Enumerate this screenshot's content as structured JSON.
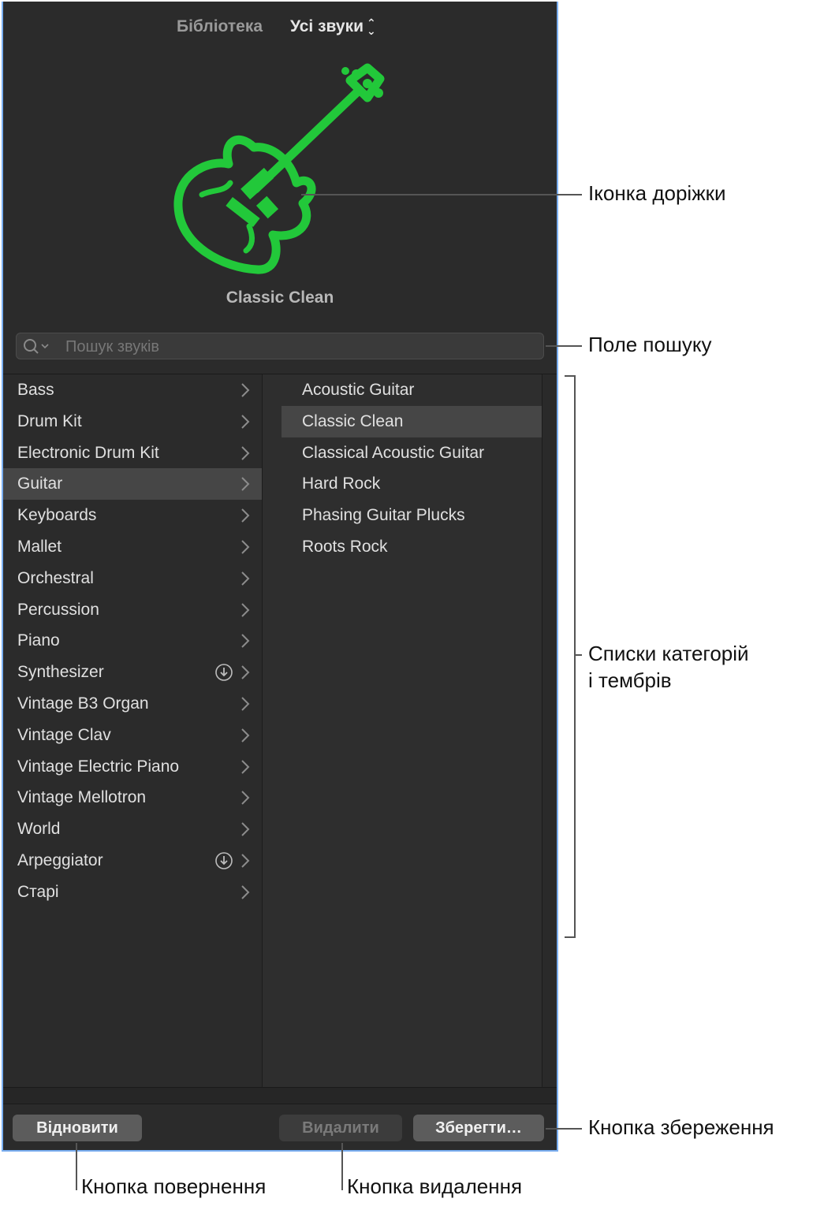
{
  "header": {
    "library_label": "Бібліотека",
    "filter_label": "Усі звуки"
  },
  "track": {
    "icon": "guitar-icon",
    "color": "#22c83a",
    "patch_name": "Classic Clean"
  },
  "search": {
    "placeholder": "Пошук звуків",
    "value": ""
  },
  "categories": [
    {
      "label": "Bass",
      "download": false
    },
    {
      "label": "Drum Kit",
      "download": false
    },
    {
      "label": "Electronic Drum Kit",
      "download": false
    },
    {
      "label": "Guitar",
      "download": false,
      "selected": true
    },
    {
      "label": "Keyboards",
      "download": false
    },
    {
      "label": "Mallet",
      "download": false
    },
    {
      "label": "Orchestral",
      "download": false
    },
    {
      "label": "Percussion",
      "download": false
    },
    {
      "label": "Piano",
      "download": false
    },
    {
      "label": "Synthesizer",
      "download": true
    },
    {
      "label": "Vintage B3 Organ",
      "download": false
    },
    {
      "label": "Vintage Clav",
      "download": false
    },
    {
      "label": "Vintage Electric Piano",
      "download": false
    },
    {
      "label": "Vintage Mellotron",
      "download": false
    },
    {
      "label": "World",
      "download": false
    },
    {
      "label": "Arpeggiator",
      "download": true
    },
    {
      "label": "Старі",
      "download": false
    }
  ],
  "patches": [
    {
      "label": "Acoustic Guitar"
    },
    {
      "label": "Classic Clean",
      "selected": true
    },
    {
      "label": "Classical Acoustic Guitar"
    },
    {
      "label": "Hard Rock"
    },
    {
      "label": "Phasing Guitar Plucks"
    },
    {
      "label": "Roots Rock"
    }
  ],
  "footer": {
    "revert_label": "Відновити",
    "delete_label": "Видалити",
    "save_label": "Зберегти…"
  },
  "callouts": {
    "track_icon": "Іконка доріжки",
    "search_field": "Поле пошуку",
    "lists_line1": "Списки категорій",
    "lists_line2": "і тембрів",
    "save_button": "Кнопка збереження",
    "revert_button": "Кнопка повернення",
    "delete_button": "Кнопка видалення"
  }
}
